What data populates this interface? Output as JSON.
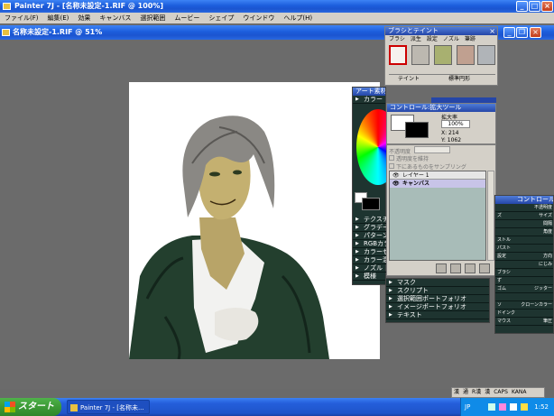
{
  "app_title": "Painter 7J - [名称未設定-1.RIF @ 100%]",
  "menu": [
    "ファイル(F)",
    "編集(E)",
    "効果",
    "キャンバス",
    "選択範囲",
    "ムービー",
    "シェイプ",
    "ウインドウ",
    "ヘルプ(H)"
  ],
  "doc_title": "名称未設定-1.RIF @ 51%",
  "brush_panel": {
    "title": "ブラシとテイント",
    "tabs": [
      "ブラシ",
      "派生",
      "設定",
      "ノズル",
      "筆跡"
    ],
    "status_left": "テイント",
    "status_right": "標準円形"
  },
  "art_panel": {
    "title": "アート素材",
    "color_label": "カラー",
    "rows": [
      "テクスチャ",
      "グラデーション",
      "パターン",
      "RGBカラー",
      "カラーセット",
      "カラー混合",
      "ノズル",
      "模様"
    ]
  },
  "nav_panel": {
    "title": "コントロール:拡大ツール",
    "zoom_label": "拡大率",
    "zoom_value": "100%",
    "x_label": "X: 214",
    "y_label": "Y: 1062"
  },
  "layers_panel": {
    "opacity_label": "不透明度",
    "keep_trans": "透明度を維持",
    "sample": "下にあるものをサンプリング",
    "layer1": "レイヤー 1",
    "canvas": "キャンバス"
  },
  "lower_panel": {
    "rows": [
      "マスク",
      "スクリプト",
      "選択範囲ポートフォリオ",
      "イメージポートフォリオ",
      "テキスト"
    ]
  },
  "right_panel": {
    "title": "コントロール",
    "rows": [
      {
        "l": "",
        "r": "不透明度"
      },
      {
        "l": "ズ",
        "r": "サイズ"
      },
      {
        "l": "",
        "r": "間隔"
      },
      {
        "l": "",
        "r": "角度"
      },
      {
        "l": "ストル",
        "r": ""
      },
      {
        "l": "パスト",
        "r": ""
      },
      {
        "l": "設定",
        "r": "方向"
      },
      {
        "l": "",
        "r": "にじみ"
      },
      {
        "l": "ブラシ",
        "r": ""
      },
      {
        "l": "ず",
        "r": ""
      },
      {
        "l": "ゴム",
        "r": "ジッター"
      },
      {
        "l": "",
        "r": ""
      },
      {
        "l": "ソ",
        "r": "クローンカラー"
      },
      {
        "l": "ドインク",
        "r": ""
      },
      {
        "l": "マウス",
        "r": "筆圧"
      }
    ]
  },
  "taskbar": {
    "start": "スタート",
    "task": "Painter 7J - [名称未...",
    "time": "1:52",
    "ime": "JP"
  },
  "ime_bar": [
    "漢",
    "通",
    "R漢",
    "漢",
    "CAPS",
    "KANA"
  ]
}
